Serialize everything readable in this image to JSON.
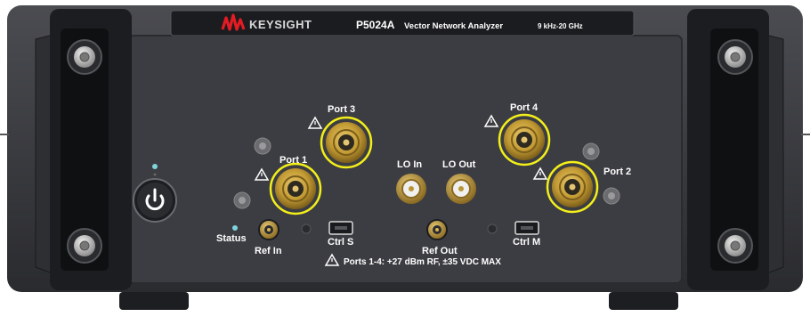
{
  "brand": {
    "name": "KEYSIGHT",
    "logo_color": "#e41b23"
  },
  "header": {
    "model": "P5024A",
    "product": "Vector Network Analyzer",
    "range": "9 kHz-20 GHz"
  },
  "ports": {
    "port1": "Port 1",
    "port2": "Port 2",
    "port3": "Port 3",
    "port4": "Port 4",
    "lo_in": "LO In",
    "lo_out": "LO Out",
    "ref_in": "Ref In",
    "ref_out": "Ref Out",
    "ctrl_s": "Ctrl S",
    "ctrl_m": "Ctrl M"
  },
  "status": {
    "label": "Status",
    "led_color": "#7fd3dc"
  },
  "power": {
    "icon": "power-icon"
  },
  "warning": {
    "icon": "warning-triangle-icon",
    "text": "Ports 1-4: +27 dBm RF, ±35 VDC MAX"
  },
  "colors": {
    "panel": "#3f4045",
    "frame": "#2b2c30",
    "connector_gold": "#c8a23c",
    "highlight_ring": "#f3ef1a"
  }
}
